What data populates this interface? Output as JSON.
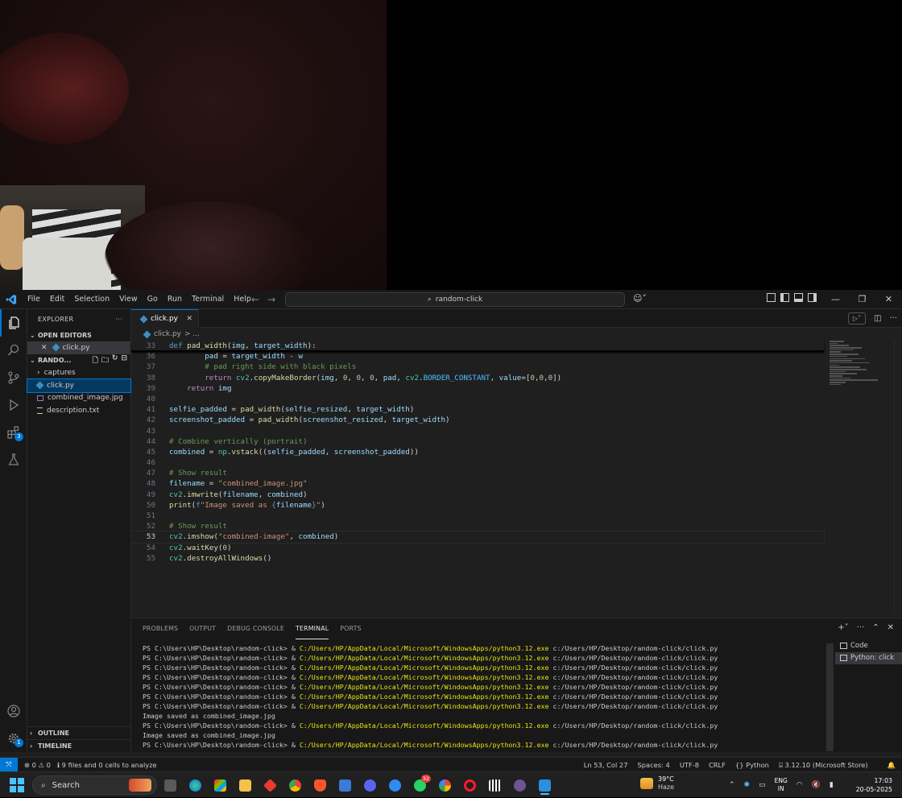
{
  "window": {
    "search_text": "random-click",
    "menu": [
      "File",
      "Edit",
      "Selection",
      "View",
      "Go",
      "Run",
      "Terminal",
      "Help"
    ]
  },
  "activity_bar": {
    "extensions_badge": "3",
    "accounts_badge": "1"
  },
  "sidebar": {
    "title": "EXPLORER",
    "open_editors_label": "OPEN EDITORS",
    "open_editor_file": "click.py",
    "project_label": "RANDO...",
    "items": [
      "captures",
      "click.py",
      "combined_image.jpg",
      "description.txt"
    ],
    "outline_label": "OUTLINE",
    "timeline_label": "TIMELINE"
  },
  "editor": {
    "tab_label": "click.py",
    "breadcrumb_file": "click.py",
    "breadcrumb_rest": "> ...",
    "lines": [
      {
        "n": "33",
        "t": "def pad_width(img, target_width):"
      },
      {
        "n": "36",
        "t": "    pad = target_width - w"
      },
      {
        "n": "37",
        "t": "    # pad right side with black pixels"
      },
      {
        "n": "38",
        "t": "    return cv2.copyMakeBorder(img, 0, 0, 0, pad, cv2.BORDER_CONSTANT, value=[0,0,0])"
      },
      {
        "n": "39",
        "t": "return img"
      },
      {
        "n": "40",
        "t": ""
      },
      {
        "n": "41",
        "t": "selfie_padded = pad_width(selfie_resized, target_width)"
      },
      {
        "n": "42",
        "t": "screenshot_padded = pad_width(screenshot_resized, target_width)"
      },
      {
        "n": "43",
        "t": ""
      },
      {
        "n": "44",
        "t": "# Combine vertically (portrait)"
      },
      {
        "n": "45",
        "t": "combined = np.vstack((selfie_padded, screenshot_padded))"
      },
      {
        "n": "46",
        "t": ""
      },
      {
        "n": "47",
        "t": "# Show result"
      },
      {
        "n": "48",
        "t": "filename = \"combined_image.jpg\""
      },
      {
        "n": "49",
        "t": "cv2.imwrite(filename, combined)"
      },
      {
        "n": "50",
        "t": "print(f\"Image saved as {filename}\")"
      },
      {
        "n": "51",
        "t": ""
      },
      {
        "n": "52",
        "t": "# Show result"
      },
      {
        "n": "53",
        "t": "cv2.imshow(\"combined-image\", combined)"
      },
      {
        "n": "54",
        "t": "cv2.waitKey(0)"
      },
      {
        "n": "55",
        "t": "cv2.destroyAllWindows()"
      }
    ]
  },
  "panel": {
    "tabs": [
      "PROBLEMS",
      "OUTPUT",
      "DEBUG CONSOLE",
      "TERMINAL",
      "PORTS"
    ],
    "active_tab": "TERMINAL",
    "prompt": "PS C:\\Users\\HP\\Desktop\\random-click> & ",
    "exe": "C:/Users/HP/AppData/Local/Microsoft/WindowsApps/python3.12.exe",
    "arg": " c:/Users/HP/Desktop/random-click/click.py",
    "saved_msg": "Image saved as combined_image.jpg",
    "terminals": [
      "Code",
      "Python: click"
    ]
  },
  "statusbar": {
    "errors": "0",
    "warnings": "0",
    "analysis": "9 files and 0 cells to analyze",
    "position": "Ln 53, Col 27",
    "spaces": "Spaces: 4",
    "encoding": "UTF-8",
    "eol": "CRLF",
    "language": "{} Python",
    "interpreter": "3.12.10 (Microsoft Store)"
  },
  "taskbar": {
    "search": "Search",
    "whatsapp_badge": "32",
    "weather_temp": "39°C",
    "weather_desc": "Haze",
    "lang_1": "ENG",
    "lang_2": "IN",
    "time": "17:03",
    "date": "20-05-2025"
  }
}
